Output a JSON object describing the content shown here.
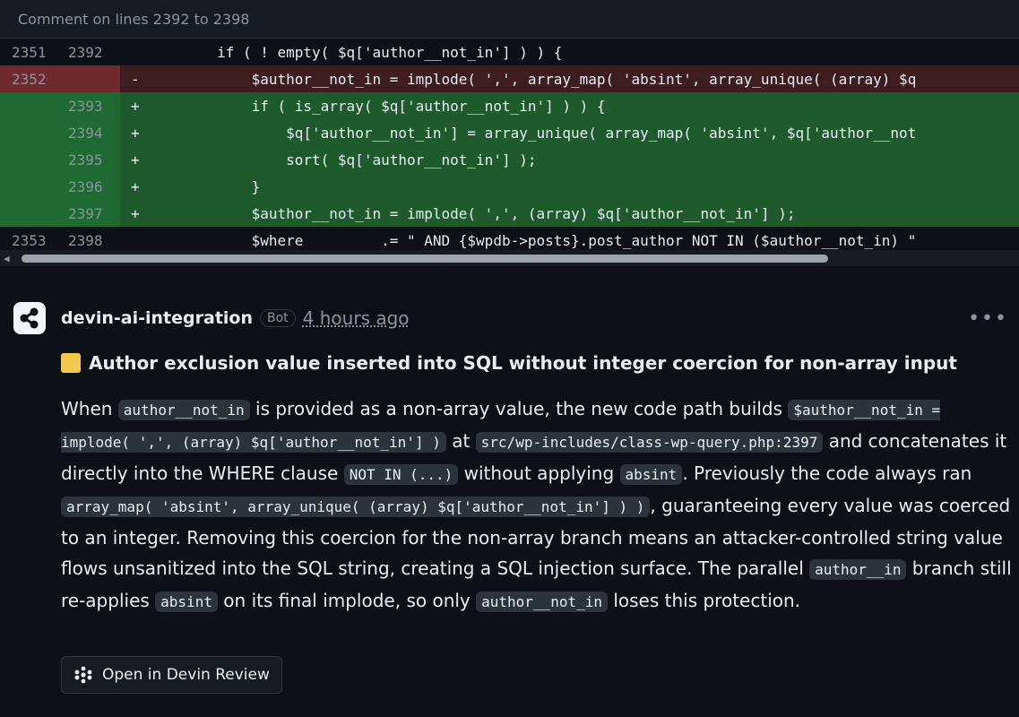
{
  "header": {
    "title": "Comment on lines 2392 to 2398"
  },
  "diff": {
    "rows": [
      {
        "type": "ctx",
        "old": "2351",
        "new": "2392",
        "sign": "",
        "code": "        if ( ! empty( $q['author__not_in'] ) ) {"
      },
      {
        "type": "del",
        "old": "2352",
        "new": "",
        "sign": "-",
        "code": "            $author__not_in = implode( ',', array_map( 'absint', array_unique( (array) $q"
      },
      {
        "type": "add",
        "old": "",
        "new": "2393",
        "sign": "+",
        "code": "            if ( is_array( $q['author__not_in'] ) ) {"
      },
      {
        "type": "add",
        "old": "",
        "new": "2394",
        "sign": "+",
        "code": "                $q['author__not_in'] = array_unique( array_map( 'absint', $q['author__not"
      },
      {
        "type": "add",
        "old": "",
        "new": "2395",
        "sign": "+",
        "code": "                sort( $q['author__not_in'] );"
      },
      {
        "type": "add",
        "old": "",
        "new": "2396",
        "sign": "+",
        "code": "            }"
      },
      {
        "type": "add",
        "old": "",
        "new": "2397",
        "sign": "+",
        "code": "            $author__not_in = implode( ',', (array) $q['author__not_in'] );"
      },
      {
        "type": "ctx",
        "old": "2353",
        "new": "2398",
        "sign": "",
        "code": "            $where         .= \" AND {$wpdb->posts}.post_author NOT IN ($author__not_in) \""
      }
    ]
  },
  "comment": {
    "author": "devin-ai-integration",
    "badge": "Bot",
    "time": "4 hours ago",
    "menu_icon": "kebab-icon",
    "title": "Author exclusion value inserted into SQL without integer coercion for non-array input",
    "body": {
      "t1": "When ",
      "c1": "author__not_in",
      "t2": " is provided as a non-array value, the new code path builds ",
      "c2": "$author__not_in = implode( ',', (array) $q['author__not_in'] )",
      "t3": " at ",
      "c3": "src/wp-includes/class-wp-query.php:2397",
      "t4": " and concatenates it directly into the WHERE clause ",
      "c4": "NOT IN (...)",
      "t5": " without applying ",
      "c5": "absint",
      "t6": ". Previously the code always ran ",
      "c6": "array_map( 'absint', array_unique( (array) $q['author__not_in'] ) )",
      "t7": ", guaranteeing every value was coerced to an integer. Removing this coercion for the non-array branch means an attacker-controlled string value flows unsanitized into the SQL string, creating a SQL injection surface. The parallel ",
      "c7": "author__in",
      "t8": " branch still re-applies ",
      "c8": "absint",
      "t9": " on its final implode, so only ",
      "c9": "author__not_in",
      "t10": " loses this protection."
    },
    "button": "Open in Devin Review"
  },
  "colors": {
    "warning": "#f2c94c",
    "added": "#1e5a2c",
    "deleted": "#3d1d20"
  }
}
